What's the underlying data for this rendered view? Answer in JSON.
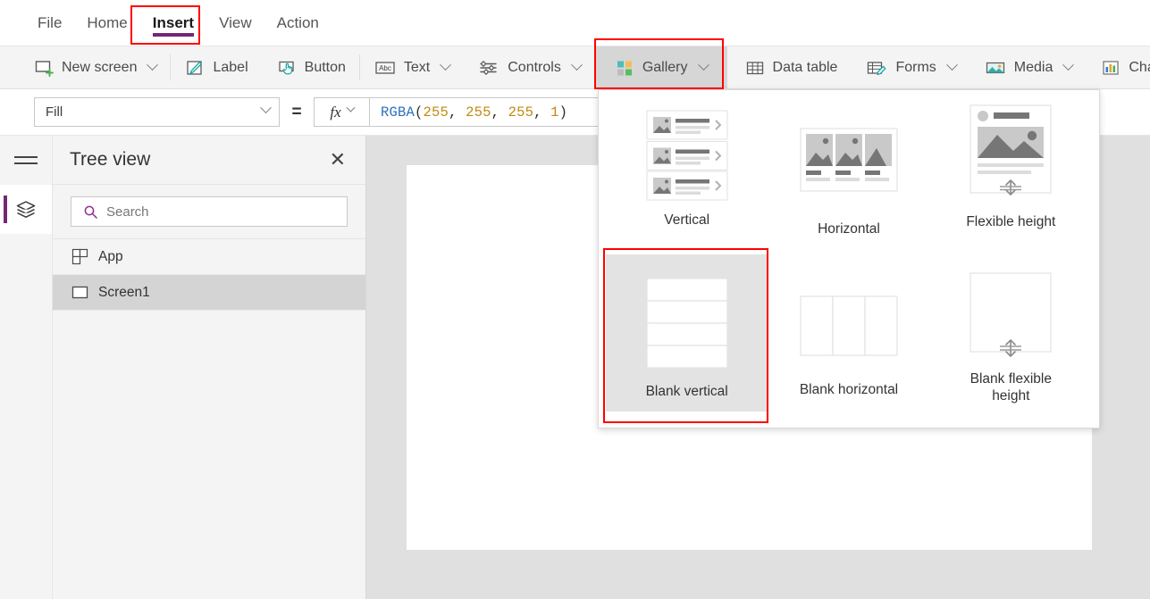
{
  "menu": {
    "items": [
      {
        "label": "File",
        "active": false
      },
      {
        "label": "Home",
        "active": false
      },
      {
        "label": "Insert",
        "active": true
      },
      {
        "label": "View",
        "active": false
      },
      {
        "label": "Action",
        "active": false
      }
    ]
  },
  "ribbon": {
    "items": [
      {
        "label": "New screen",
        "icon": "new-screen-icon",
        "caret": true,
        "selected": false
      },
      {
        "label": "Label",
        "icon": "label-icon",
        "caret": false,
        "selected": false
      },
      {
        "label": "Button",
        "icon": "button-icon",
        "caret": false,
        "selected": false
      },
      {
        "label": "Text",
        "icon": "text-icon",
        "caret": true,
        "selected": false
      },
      {
        "label": "Controls",
        "icon": "controls-icon",
        "caret": true,
        "selected": false
      },
      {
        "label": "Gallery",
        "icon": "gallery-icon",
        "caret": true,
        "selected": true
      },
      {
        "label": "Data table",
        "icon": "data-table-icon",
        "caret": false,
        "selected": false
      },
      {
        "label": "Forms",
        "icon": "forms-icon",
        "caret": true,
        "selected": false
      },
      {
        "label": "Media",
        "icon": "media-icon",
        "caret": true,
        "selected": false
      },
      {
        "label": "Char",
        "icon": "charts-icon",
        "caret": false,
        "selected": false
      }
    ]
  },
  "formula_bar": {
    "property": "Fill",
    "equals": "=",
    "fx": "fx",
    "formula_function": "RGBA",
    "formula_open": "(",
    "formula_args": [
      "255",
      "255",
      "255",
      "1"
    ],
    "formula_close": ")",
    "formula_full": "RGBA(255, 255, 255, 1)"
  },
  "tree_view": {
    "title": "Tree view",
    "close_label": "✕",
    "search_placeholder": "Search",
    "rows": [
      {
        "label": "App",
        "icon": "app-icon",
        "selected": false
      },
      {
        "label": "Screen1",
        "icon": "screen-icon",
        "selected": true
      }
    ]
  },
  "gallery_flyout": {
    "items": [
      {
        "label": "Vertical",
        "thumb": "vertical-gallery-thumb",
        "selected": false
      },
      {
        "label": "Horizontal",
        "thumb": "horizontal-gallery-thumb",
        "selected": false
      },
      {
        "label": "Flexible height",
        "thumb": "flexible-height-gallery-thumb",
        "selected": false
      },
      {
        "label": "Blank vertical",
        "thumb": "blank-vertical-gallery-thumb",
        "selected": true
      },
      {
        "label": "Blank horizontal",
        "thumb": "blank-horizontal-gallery-thumb",
        "selected": false
      },
      {
        "label": "Blank flexible height",
        "thumb": "blank-flexible-height-gallery-thumb",
        "selected": false
      }
    ]
  },
  "annotations": {
    "color": "#ff0000",
    "boxes": [
      "insert-tab-highlight",
      "gallery-button-highlight",
      "blank-vertical-highlight"
    ]
  },
  "colors": {
    "accent_purple": "#742774",
    "annotation_red": "#ff0000",
    "ribbon_bg": "#f4f4f4",
    "workarea_bg": "#e0e0e0",
    "selected_row": "#d4d4d4"
  }
}
